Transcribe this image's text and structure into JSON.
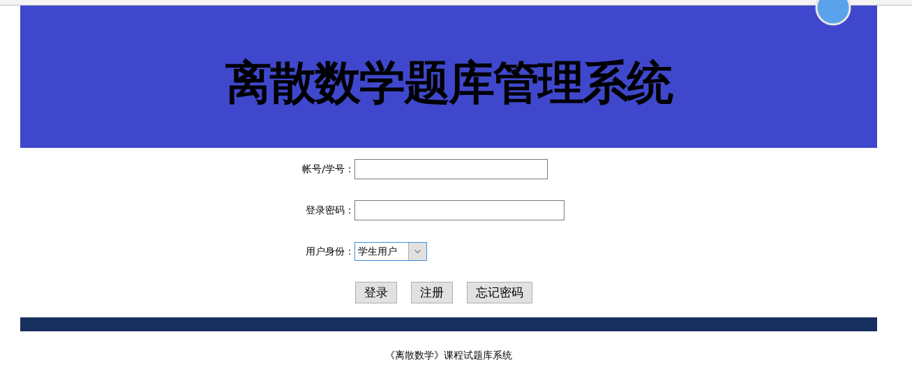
{
  "header": {
    "title": "离散数学题库管理系统"
  },
  "form": {
    "fields": [
      {
        "kind": "text",
        "label": "帐号/学号："
      },
      {
        "kind": "password",
        "label": "登录密码："
      },
      {
        "kind": "select",
        "label": "用户身份：",
        "value": "学生用户"
      }
    ],
    "buttons": [
      "登录",
      "注册",
      "忘记密码"
    ]
  },
  "footer": {
    "text": "《离散数学》课程试题库系统"
  }
}
